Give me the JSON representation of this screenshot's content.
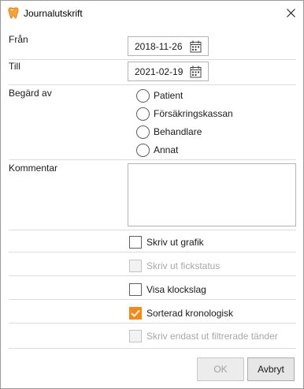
{
  "window": {
    "title": "Journalutskrift",
    "icon": "tooth-icon",
    "accent_color": "#f08c1e"
  },
  "from": {
    "label": "Från",
    "value": "2018-11-26"
  },
  "to": {
    "label": "Till",
    "value": "2021-02-19"
  },
  "requested_by": {
    "label": "Begärd av",
    "options": [
      "Patient",
      "Försäkringskassan",
      "Behandlare",
      "Annat"
    ]
  },
  "comment": {
    "label": "Kommentar",
    "value": ""
  },
  "options": [
    {
      "label": "Skriv ut grafik",
      "checked": false,
      "disabled": false
    },
    {
      "label": "Skriv ut fickstatus",
      "checked": false,
      "disabled": true
    },
    {
      "label": "Visa klockslag",
      "checked": false,
      "disabled": false
    },
    {
      "label": "Sorterad kronologisk",
      "checked": true,
      "disabled": false
    },
    {
      "label": "Skriv endast ut filtrerade tänder",
      "checked": false,
      "disabled": true
    }
  ],
  "buttons": {
    "ok": "OK",
    "cancel": "Avbryt"
  }
}
